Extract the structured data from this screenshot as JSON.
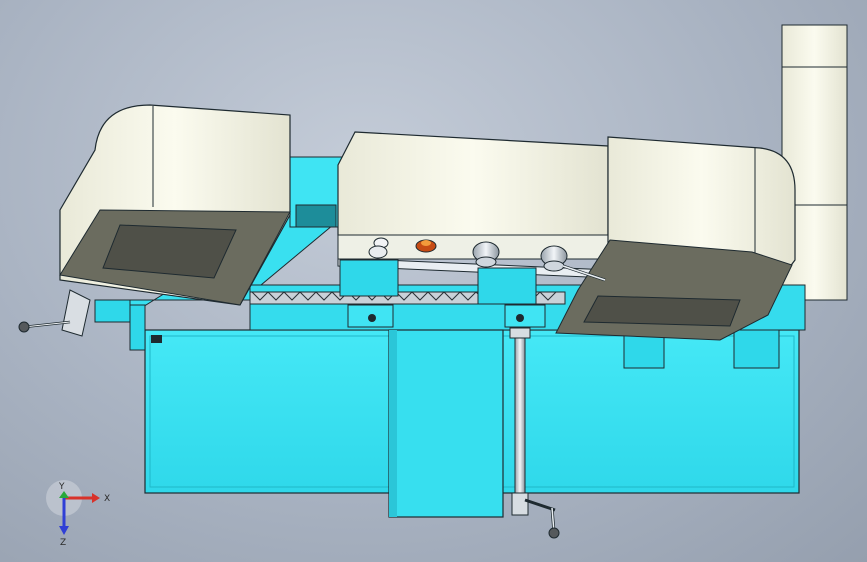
{
  "viewport": {
    "background": "#b0b9c6",
    "model": "band-saw-machine-assembly"
  },
  "colors": {
    "frame_cyan": "#35e3f3",
    "frame_cyan_dark": "#1fb7c8",
    "frame_cyan_light": "#8ef3fb",
    "housing_cream": "#f6f6e9",
    "housing_cream_shade": "#d8d8c7",
    "housing_dark": "#6b6c5f",
    "steel": "#cfd6dd",
    "outline": "#1e2a30",
    "knob_orange": "#e06b1e"
  },
  "triad": {
    "x_label": "X",
    "y_label": "Y",
    "z_label": "Z",
    "x_color": "#d8322a",
    "y_color": "#29a83a",
    "z_color": "#2f3fd6"
  }
}
